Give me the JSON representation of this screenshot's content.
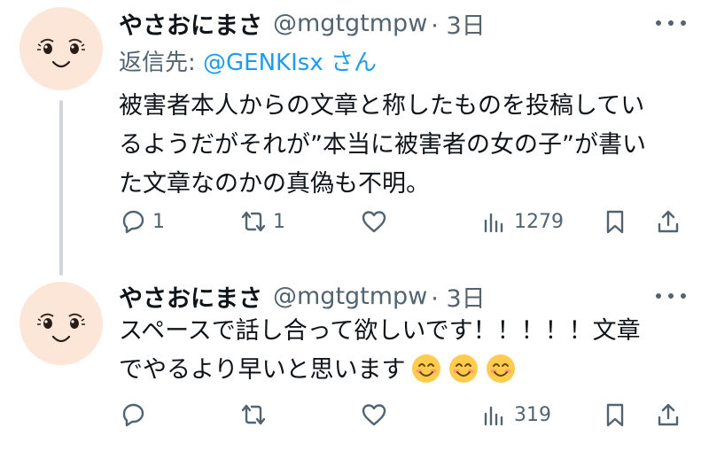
{
  "tweets": [
    {
      "display_name": "やさおにまさ",
      "handle": "@mgtgtmpw",
      "time": "· 3日",
      "reply_prefix": "返信先: ",
      "reply_mention": "@GENKIsx",
      "reply_suffix": " さん",
      "lines": [
        "被害者本人からの文章と称したものを投稿してい",
        "るようだがそれが”本当に被害者の女の子”が書い",
        "た文章なのかの真偽も不明。"
      ],
      "reply_count": "1",
      "retweet_count": "1",
      "like_count": "",
      "views": "1279"
    },
    {
      "display_name": "やさおにまさ",
      "handle": "@mgtgtmpw",
      "time": "· 3日",
      "lines": [
        "スペースで話し合って欲しいです！！！！！文章",
        "でやるより早いと思います"
      ],
      "reply_count": "",
      "retweet_count": "",
      "like_count": "",
      "views": "319"
    }
  ],
  "icons": [
    "more-icon",
    "reply-icon",
    "retweet-icon",
    "like-icon",
    "views-icon",
    "bookmark-icon",
    "share-icon",
    "smiling-face-emoji"
  ],
  "colors": {
    "text": "#0f1419",
    "muted": "#536471",
    "link": "#1d9bf0",
    "avatar_bg": "#fbe6d8"
  }
}
